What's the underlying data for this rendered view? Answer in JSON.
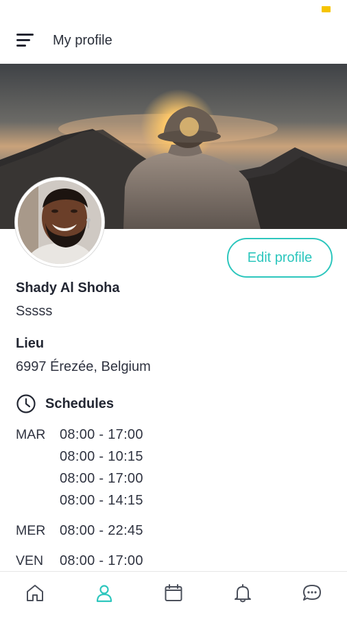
{
  "header": {
    "title": "My profile",
    "menu_icon": "hamburger-menu-icon"
  },
  "profile": {
    "name": "Shady Al Shoha",
    "bio": "Sssss",
    "edit_label": "Edit profile",
    "location_label": "Lieu",
    "location_value": "6997 Érezée, Belgium"
  },
  "schedules": {
    "title": "Schedules",
    "icon": "clock-icon",
    "days": [
      {
        "day": "MAR",
        "times": [
          "08:00 - 17:00",
          "08:00 - 10:15",
          "08:00 - 17:00",
          "08:00 - 14:15"
        ]
      },
      {
        "day": "MER",
        "times": [
          "08:00 - 22:45"
        ]
      },
      {
        "day": "VEN",
        "times": [
          "08:00 - 17:00"
        ]
      }
    ]
  },
  "nav": {
    "items": [
      {
        "icon": "home-icon",
        "active": false
      },
      {
        "icon": "profile-icon",
        "active": true
      },
      {
        "icon": "calendar-icon",
        "active": false
      },
      {
        "icon": "bell-icon",
        "active": false
      },
      {
        "icon": "chat-icon",
        "active": false
      }
    ]
  },
  "colors": {
    "accent": "#2cc6bd",
    "text": "#232733",
    "icon": "#4a4f5a",
    "status": "#f6c400"
  }
}
